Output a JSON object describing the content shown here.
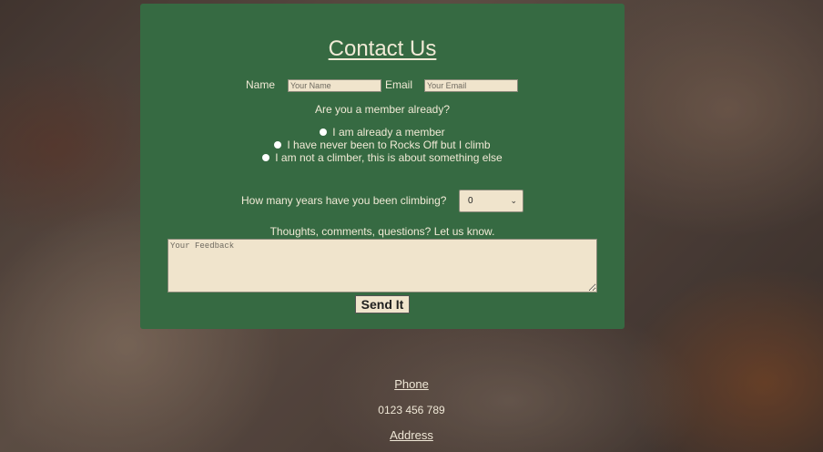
{
  "form": {
    "title": "Contact Us",
    "name_label": "Name",
    "name_placeholder": "Your Name",
    "email_label": "Email",
    "email_placeholder": "Your Email",
    "member_question": "Are you a member already?",
    "radio_options": [
      "I am already a member",
      "I have never been to Rocks Off but I climb",
      "I am not a climber, this is about something else"
    ],
    "years_question": "How many years have you been climbing?",
    "years_selected": "0",
    "feedback_prompt": "Thoughts, comments, questions? Let us know.",
    "feedback_placeholder": "Your Feedback",
    "submit_label": "Send It"
  },
  "footer": {
    "phone_label": "Phone",
    "phone_number": "0123 456 789",
    "address_label": "Address"
  },
  "colors": {
    "panel_bg": "#366a42",
    "input_bg": "#f0e4cc",
    "text": "#f1ead6"
  }
}
